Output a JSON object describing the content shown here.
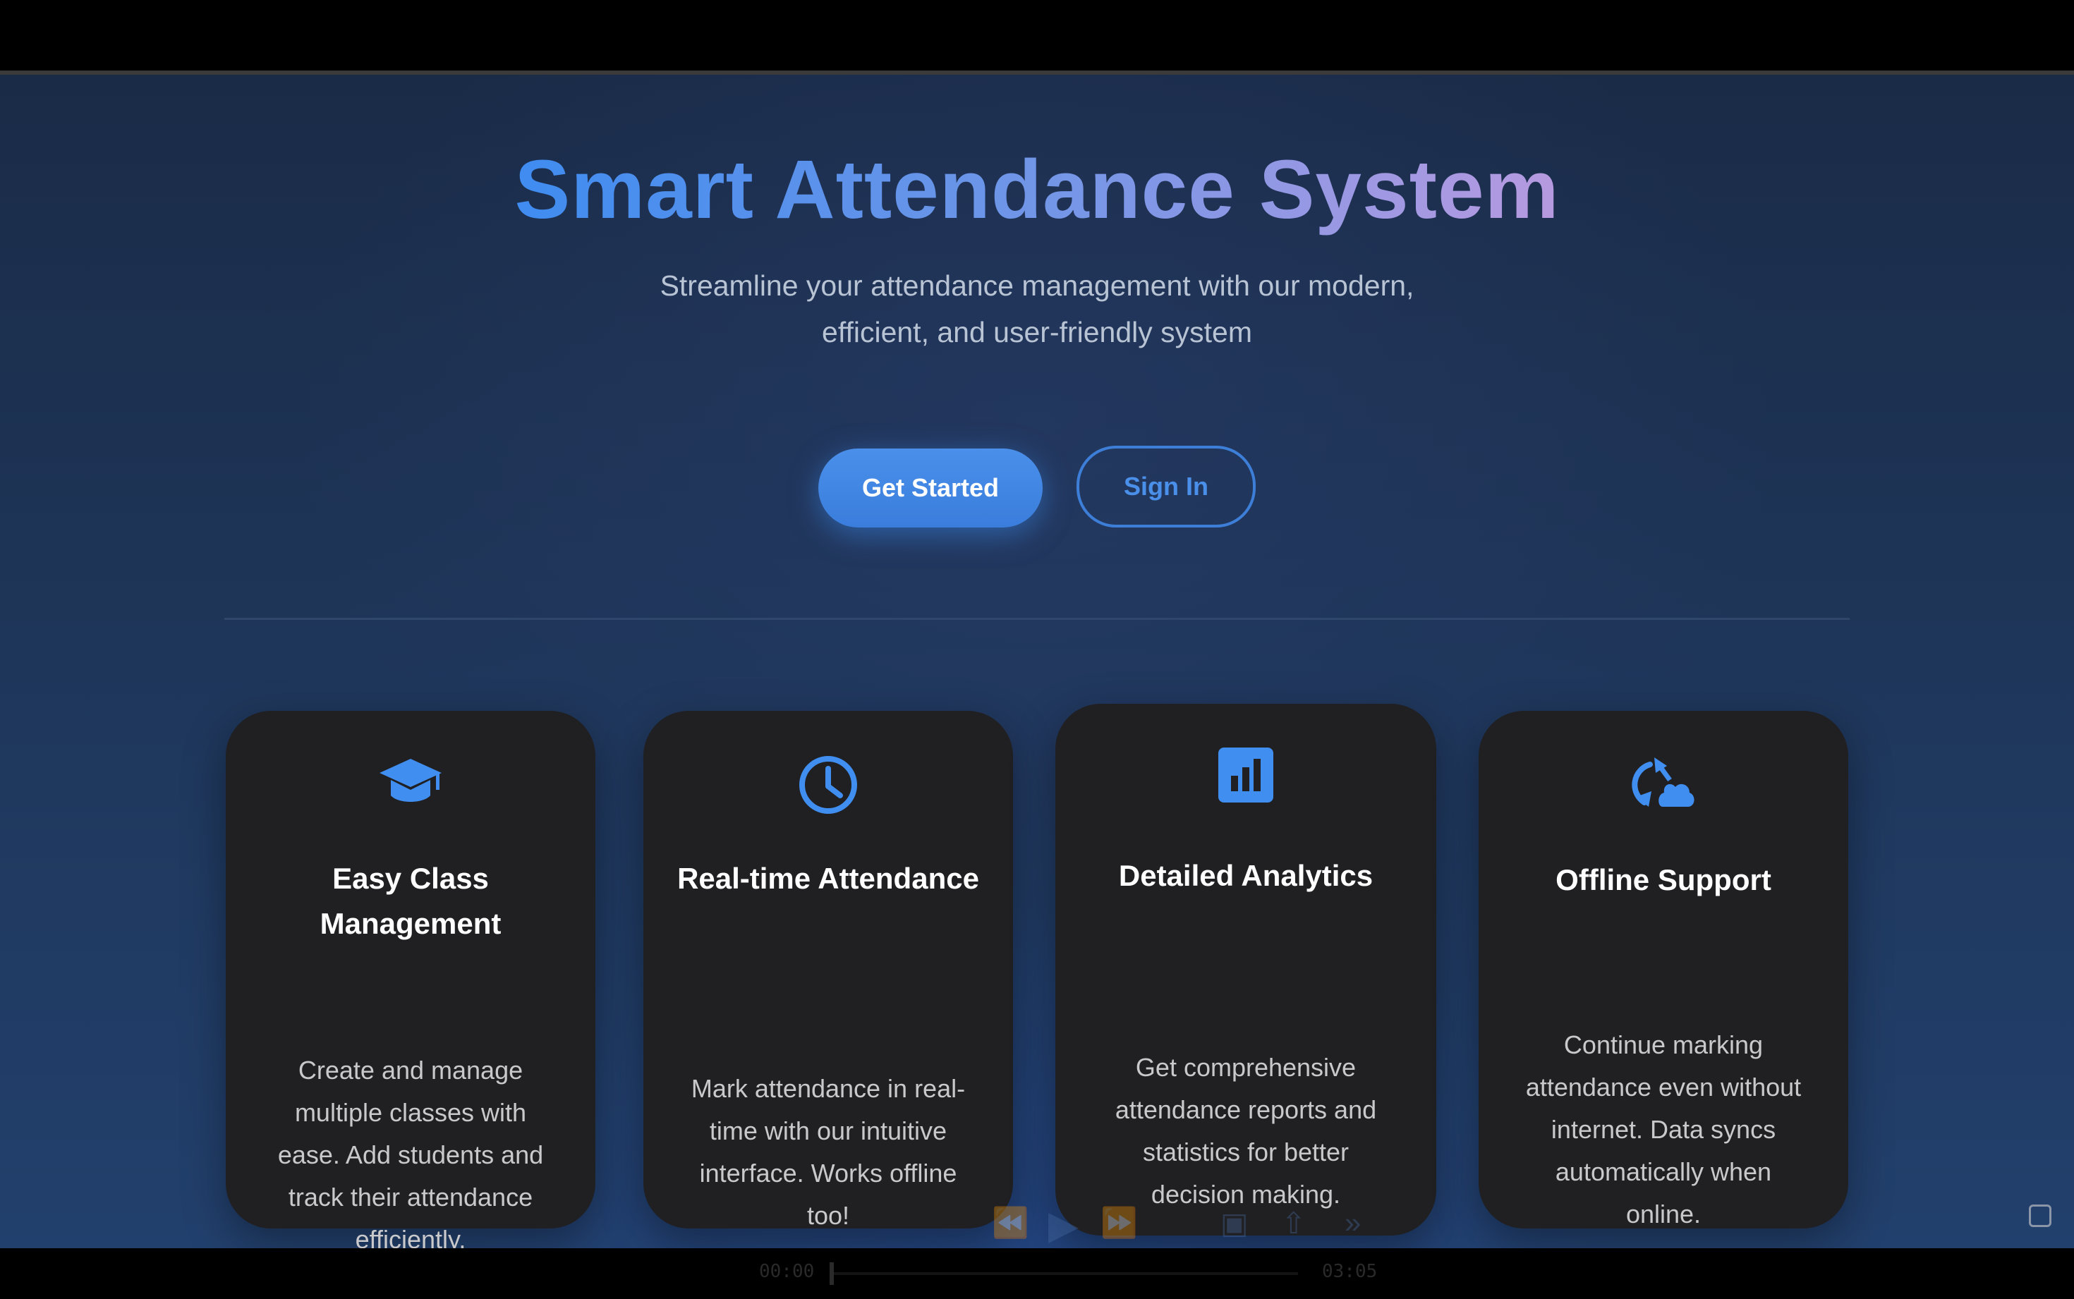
{
  "hero": {
    "title": "Smart Attendance System",
    "subtitle": "Streamline your attendance management with our modern, efficient, and user-friendly system",
    "primary_button": "Get Started",
    "secondary_button": "Sign In"
  },
  "features": [
    {
      "icon": "graduation-cap-icon",
      "title": "Easy Class Management",
      "description": "Create and manage multiple classes with ease. Add students and track their attendance efficiently."
    },
    {
      "icon": "clock-icon",
      "title": "Real-time Attendance",
      "description": "Mark attendance in real-time with our intuitive interface. Works offline too!"
    },
    {
      "icon": "bar-chart-icon",
      "title": "Detailed Analytics",
      "description": "Get comprehensive attendance reports and statistics for better decision making."
    },
    {
      "icon": "cloud-sync-icon",
      "title": "Offline Support",
      "description": "Continue marking attendance even without internet. Data syncs automatically when online."
    }
  ],
  "player": {
    "time_current": "00:00",
    "time_total": "03:05"
  },
  "colors": {
    "accent": "#4a90ea",
    "card_bg": "#202022",
    "title_gradient_start": "#3f8cf0",
    "title_gradient_end": "#b79ae0"
  }
}
